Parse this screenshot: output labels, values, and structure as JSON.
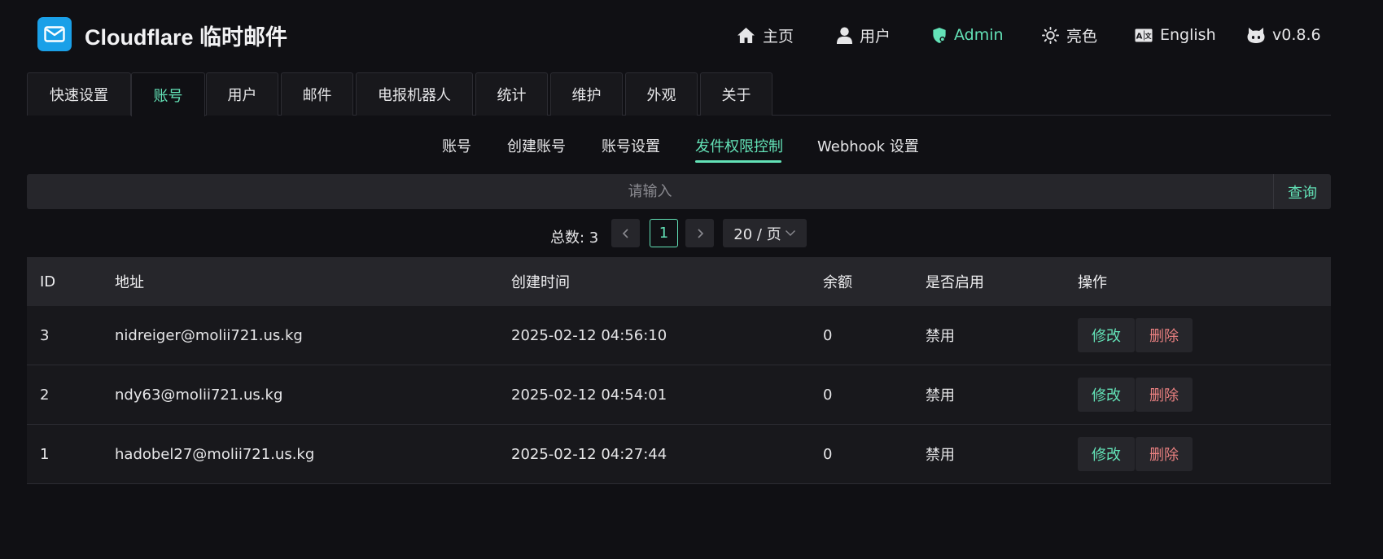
{
  "app": {
    "title": "Cloudflare 临时邮件"
  },
  "nav": {
    "home": "主页",
    "user": "用户",
    "admin": "Admin",
    "theme": "亮色",
    "language": "English",
    "version": "v0.8.6"
  },
  "tabs": [
    {
      "label": "快速设置"
    },
    {
      "label": "账号"
    },
    {
      "label": "用户"
    },
    {
      "label": "邮件"
    },
    {
      "label": "电报机器人"
    },
    {
      "label": "统计"
    },
    {
      "label": "维护"
    },
    {
      "label": "外观"
    },
    {
      "label": "关于"
    }
  ],
  "active_tab": "账号",
  "subtabs": [
    {
      "label": "账号"
    },
    {
      "label": "创建账号"
    },
    {
      "label": "账号设置"
    },
    {
      "label": "发件权限控制"
    },
    {
      "label": "Webhook 设置"
    }
  ],
  "active_subtab": "发件权限控制",
  "search": {
    "placeholder": "请输入",
    "value": "",
    "button": "查询"
  },
  "pagination": {
    "total": "总数: 3",
    "current_page": "1",
    "page_size": "20 / 页"
  },
  "table": {
    "headers": {
      "id": "ID",
      "address": "地址",
      "created": "创建时间",
      "balance": "余额",
      "enabled": "是否启用",
      "actions": "操作"
    },
    "rows": [
      {
        "id": "3",
        "address": "nidreiger@molii721.us.kg",
        "created": "2025-02-12 04:56:10",
        "balance": "0",
        "enabled": "禁用",
        "edit": "修改",
        "delete": "删除"
      },
      {
        "id": "2",
        "address": "ndy63@molii721.us.kg",
        "created": "2025-02-12 04:54:01",
        "balance": "0",
        "enabled": "禁用",
        "edit": "修改",
        "delete": "删除"
      },
      {
        "id": "1",
        "address": "hadobel27@molii721.us.kg",
        "created": "2025-02-12 04:27:44",
        "balance": "0",
        "enabled": "禁用",
        "edit": "修改",
        "delete": "删除"
      }
    ]
  },
  "colors": {
    "background": "#101014",
    "accent": "#63e2b7",
    "danger": "#e88080",
    "logo": "#1aa0e8"
  }
}
